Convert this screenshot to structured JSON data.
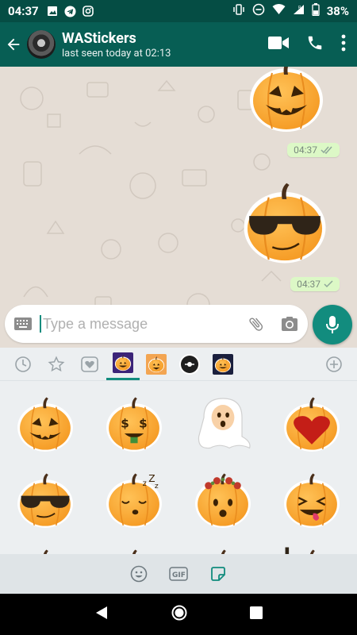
{
  "status_bar": {
    "time": "04:37",
    "battery": "38%"
  },
  "header": {
    "title": "WAStickers",
    "subtitle": "last seen today at 02:13",
    "icons": [
      "back-arrow-icon",
      "video-call-icon",
      "phone-call-icon",
      "more-options-icon"
    ]
  },
  "chat": {
    "messages": [
      {
        "type": "sticker",
        "sticker": "jack-o-lantern",
        "time": "04:37",
        "status": "read"
      },
      {
        "type": "sticker",
        "sticker": "pumpkin-sunglasses",
        "time": "04:37",
        "status": "delivered"
      }
    ]
  },
  "composer": {
    "placeholder": "Type a message",
    "value": ""
  },
  "sticker_tray": {
    "tabs": [
      "recent-icon",
      "favorites-icon",
      "loved-icon",
      "pack-1",
      "pack-2",
      "pack-3",
      "pack-4",
      "add-icon"
    ],
    "selected_tab": "pack-1",
    "stickers": [
      "jack-o-lantern",
      "money-eyes",
      "ghost",
      "heart",
      "sunglasses",
      "sleeping",
      "flower-crown",
      "wink-tongue",
      "partial",
      "partial",
      "partial",
      "partial"
    ]
  },
  "bottom_bar": {
    "icons": [
      "emoji-icon",
      "gif-icon",
      "sticker-icon"
    ],
    "gif_label": "GIF"
  },
  "colors": {
    "primary": "#075e54",
    "status_bar": "#054d44",
    "accent": "#128c7e",
    "outgoing_bubble": "#dcf8c6",
    "chat_bg": "#e5ddd5",
    "read_ticks": "#34b7f1"
  }
}
